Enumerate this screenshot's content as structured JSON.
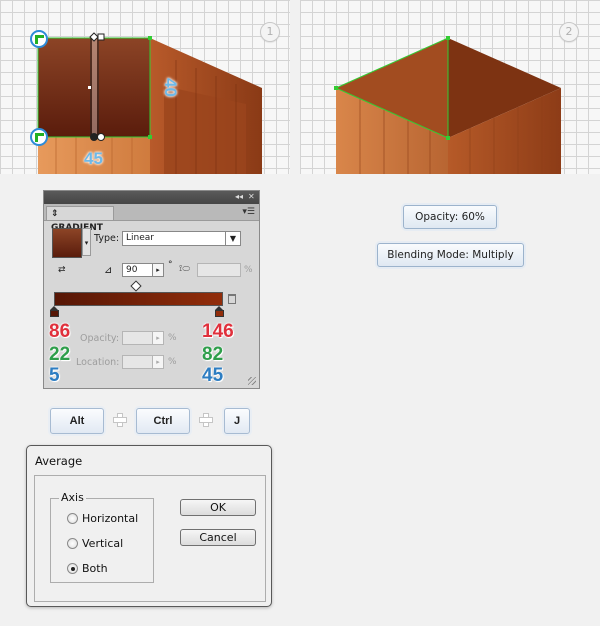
{
  "step_markers": [
    "1",
    "2"
  ],
  "dimensions": {
    "height": "40",
    "width": "45"
  },
  "gradient_panel": {
    "tab": "GRADIENT",
    "type_label": "Type:",
    "type_value": "Linear",
    "angle_value": "90",
    "degree_symbol": "°",
    "aspect_unit": "%",
    "opacity_label": "Opacity:",
    "opacity_unit": "%",
    "location_label": "Location:",
    "location_unit": "%",
    "stop_left_rgb": [
      "86",
      "22",
      "5"
    ],
    "stop_right_rgb": [
      "146",
      "82",
      "45"
    ],
    "stop_left_color": "#561605",
    "stop_right_color": "#922d0a"
  },
  "info_buttons": {
    "opacity": "Opacity: 60%",
    "blending": "Blending Mode: Multiply"
  },
  "shortcut": {
    "keys": [
      "Alt",
      "Ctrl",
      "J"
    ]
  },
  "average_dialog": {
    "title": "Average",
    "axis_label": "Axis",
    "options": [
      "Horizontal",
      "Vertical",
      "Both"
    ],
    "selected": "Both",
    "ok": "OK",
    "cancel": "Cancel"
  },
  "colors": {
    "accent_blue": "#2d8bd8",
    "selection_green": "#33cc33",
    "red": "#e0303c",
    "green": "#2e9e4a",
    "blue": "#2d7dc2"
  }
}
